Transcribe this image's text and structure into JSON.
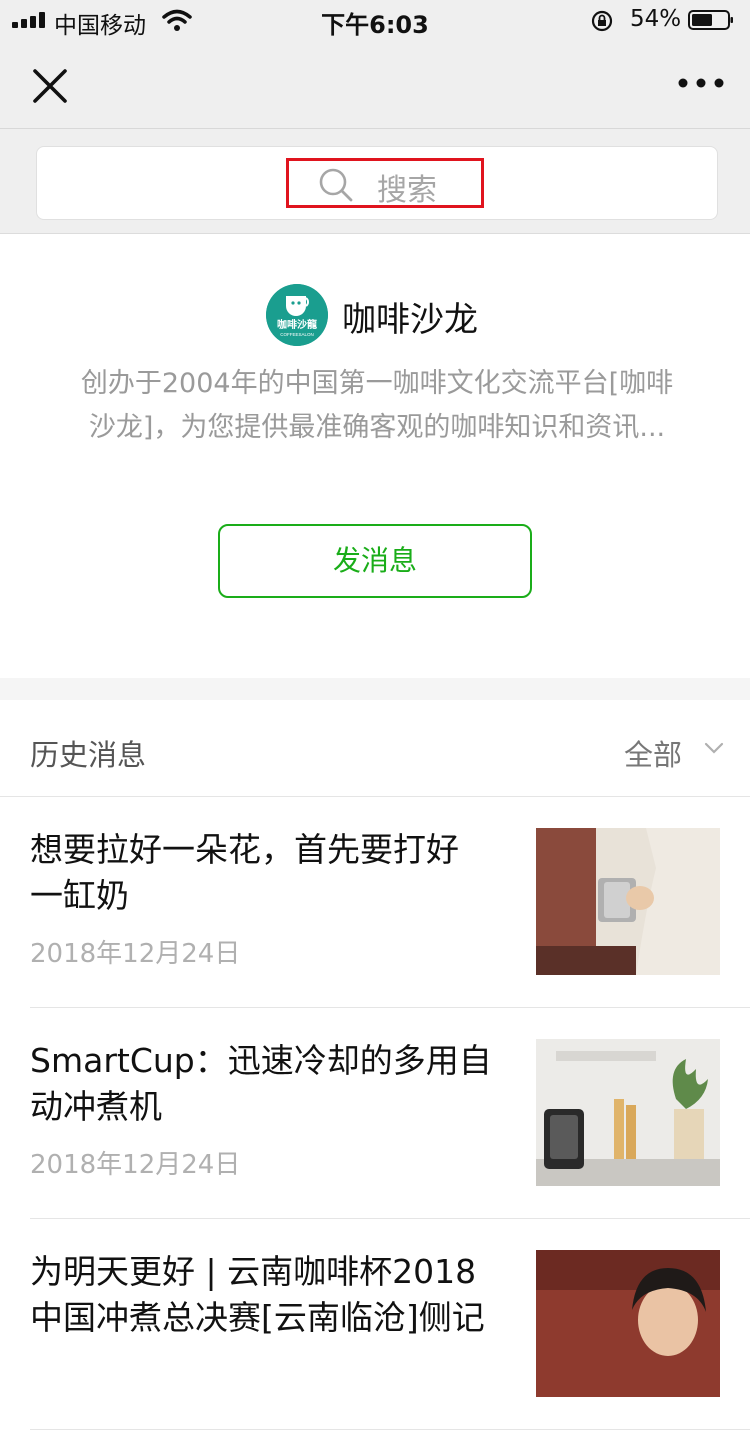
{
  "status_bar": {
    "carrier": "中国移动",
    "time": "下午6:03",
    "battery": "54%"
  },
  "search": {
    "placeholder": "搜索"
  },
  "account": {
    "name": "咖啡沙龙",
    "logo_text": "咖啡沙龍",
    "logo_subtext": "COFFEESALON",
    "description_lines": [
      "创办于2004年的中国第一咖啡文化交流平台[咖啡",
      "沙龙]，为您提供最准确客观的咖啡知识和资讯..."
    ]
  },
  "actions": {
    "send_message": "发消息"
  },
  "history": {
    "title": "历史消息",
    "filter": "全部",
    "articles": [
      {
        "title_lines": [
          "想要拉好一朵花，首先要打好",
          "一缸奶"
        ],
        "date": "2018年12月24日"
      },
      {
        "title_lines": [
          "SmartCup：迅速冷却的多用自",
          "动冲煮机"
        ],
        "date": "2018年12月24日"
      },
      {
        "title_lines": [
          "为明天更好 | 云南咖啡杯2018",
          "中国冲煮总决赛[云南临沧]侧记"
        ],
        "date": ""
      }
    ]
  },
  "colors": {
    "accent": "#1aad19",
    "highlight": "#e0141e",
    "logo_bg": "#1a9e8f"
  },
  "icons": [
    "signal-icon",
    "wifi-icon",
    "rotation-lock-icon",
    "battery-icon",
    "close-icon",
    "more-icon",
    "search-icon",
    "chevron-down-icon"
  ]
}
